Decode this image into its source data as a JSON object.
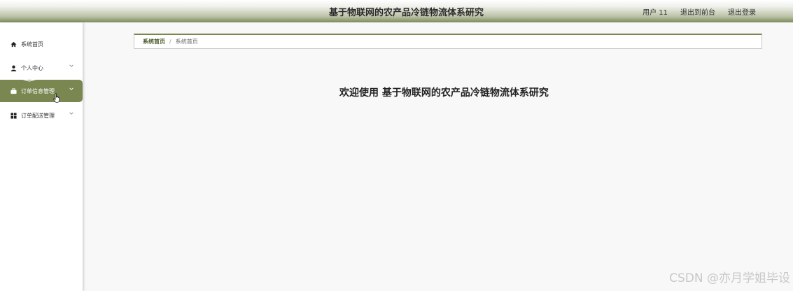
{
  "header": {
    "title": "基于物联网的农产品冷链物流体系研究",
    "user_label": "用户 11",
    "back_to_front_label": "退出到前台",
    "logout_label": "退出登录"
  },
  "sidebar": {
    "items": [
      {
        "label": "系统首页",
        "icon": "home-icon",
        "has_submenu": false
      },
      {
        "label": "个人中心",
        "icon": "user-icon",
        "has_submenu": true
      },
      {
        "label": "订单信息管理",
        "icon": "briefcase-icon",
        "has_submenu": true,
        "active": true
      },
      {
        "label": "订单配送管理",
        "icon": "grid-icon",
        "has_submenu": true
      }
    ]
  },
  "breadcrumb": {
    "home": "系统首页",
    "separator": "/",
    "current": "系统首页"
  },
  "main": {
    "welcome": "欢迎使用 基于物联网的农产品冷链物流体系研究"
  },
  "watermark": "CSDN @亦月学姐毕设",
  "colors": {
    "accent": "#7a8751",
    "header_gradient_end": "#7c8a5c"
  }
}
